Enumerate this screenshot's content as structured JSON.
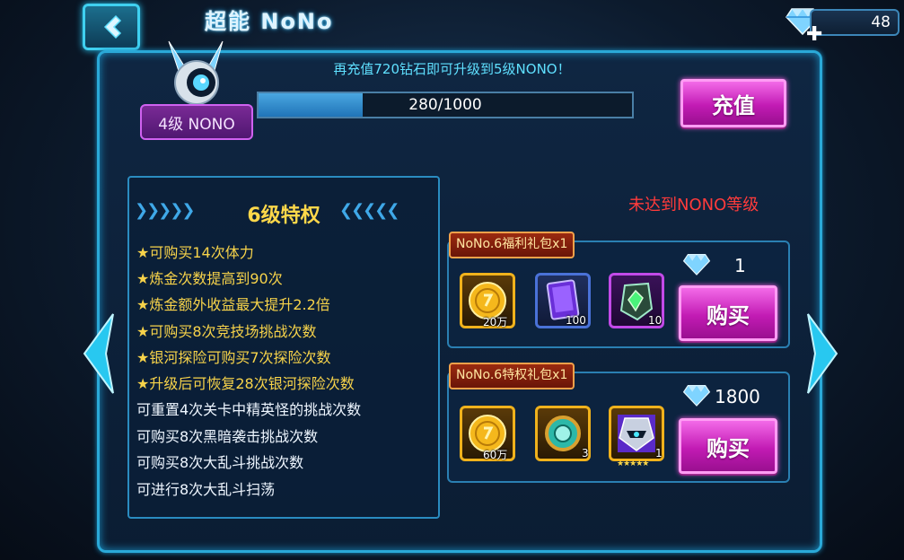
{
  "header": {
    "title": "超能 NoNo",
    "diamond_count": "48"
  },
  "promo": "再充值720钻石即可升级到5级NONO！",
  "level_badge": "4级 NONO",
  "progress": {
    "text": "280/1000",
    "current": 280,
    "max": 1000
  },
  "recharge_label": "充值",
  "privilege": {
    "title": "6级特权",
    "perks_gold": [
      "★可购买14次体力",
      "★炼金次数提高到90次",
      "★炼金额外收益最大提升2.2倍",
      "★可购买8次竞技场挑战次数",
      "★银河探险可购买7次探险次数",
      "★升级后可恢复28次银河探险次数"
    ],
    "perks_white": [
      "可重置4次关卡中精英怪的挑战次数",
      "可购买8次黑暗袭击挑战次数",
      "可购买8次大乱斗挑战次数",
      "可进行8次大乱斗扫荡"
    ]
  },
  "status": "未达到NONO等级",
  "packs": [
    {
      "label": "NoNo.6福利礼包x1",
      "price": "1",
      "buy_label": "购买",
      "items": [
        {
          "icon": "gold-coin-icon",
          "qty": "20万",
          "frame": "gold"
        },
        {
          "icon": "purple-card-icon",
          "qty": "100",
          "frame": "blue"
        },
        {
          "icon": "green-crystal-icon",
          "qty": "10",
          "frame": "purple"
        }
      ]
    },
    {
      "label": "NoNo.6特权礼包x1",
      "price": "1800",
      "buy_label": "购买",
      "items": [
        {
          "icon": "gold-coin-icon",
          "qty": "60万",
          "frame": "gold"
        },
        {
          "icon": "teal-orb-icon",
          "qty": "3",
          "frame": "gold"
        },
        {
          "icon": "armored-hero-icon",
          "qty": "1",
          "frame": "gold",
          "stars": "★★★★★"
        }
      ]
    }
  ]
}
